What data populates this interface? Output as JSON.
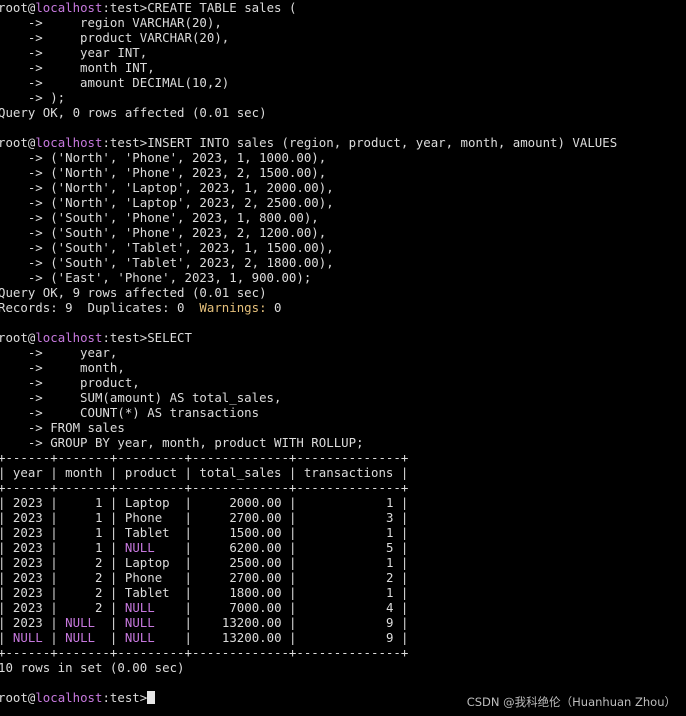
{
  "prompt": {
    "user": "root",
    "at": "@",
    "host": "localhost",
    "suffix": ":test>"
  },
  "create": {
    "command": "CREATE TABLE sales (",
    "cont": [
      "    ->     region VARCHAR(20),",
      "    ->     product VARCHAR(20),",
      "    ->     year INT,",
      "    ->     month INT,",
      "    ->     amount DECIMAL(10,2)",
      "    -> );"
    ],
    "result": "Query OK, 0 rows affected (0.01 sec)"
  },
  "insert": {
    "command": "INSERT INTO sales (region, product, year, month, amount) VALUES",
    "cont": [
      "    -> ('North', 'Phone', 2023, 1, 1000.00),",
      "    -> ('North', 'Phone', 2023, 2, 1500.00),",
      "    -> ('North', 'Laptop', 2023, 1, 2000.00),",
      "    -> ('North', 'Laptop', 2023, 2, 2500.00),",
      "    -> ('South', 'Phone', 2023, 1, 800.00),",
      "    -> ('South', 'Phone', 2023, 2, 1200.00),",
      "    -> ('South', 'Tablet', 2023, 1, 1500.00),",
      "    -> ('South', 'Tablet', 2023, 2, 1800.00),",
      "    -> ('East', 'Phone', 2023, 1, 900.00);"
    ],
    "result": "Query OK, 9 rows affected (0.01 sec)",
    "records_prefix": "Records: 9  Duplicates: 0  ",
    "warnings_label": "Warnings:",
    "warnings_value": " 0"
  },
  "select": {
    "command": "SELECT",
    "cont": [
      "    ->     year,",
      "    ->     month,",
      "    ->     product,",
      "    ->     SUM(amount) AS total_sales,",
      "    ->     COUNT(*) AS transactions",
      "    -> FROM sales",
      "    -> GROUP BY year, month, product WITH ROLLUP;"
    ]
  },
  "table": {
    "border": "+------+-------+---------+-------------+--------------+",
    "header": "| year | month | product | total_sales | transactions |",
    "rows": [
      {
        "year": "2023",
        "month": "1",
        "product": "Laptop",
        "total_sales": "2000.00",
        "transactions": "1"
      },
      {
        "year": "2023",
        "month": "1",
        "product": "Phone",
        "total_sales": "2700.00",
        "transactions": "3"
      },
      {
        "year": "2023",
        "month": "1",
        "product": "Tablet",
        "total_sales": "1500.00",
        "transactions": "1"
      },
      {
        "year": "2023",
        "month": "1",
        "product": "NULL",
        "total_sales": "6200.00",
        "transactions": "5"
      },
      {
        "year": "2023",
        "month": "2",
        "product": "Laptop",
        "total_sales": "2500.00",
        "transactions": "1"
      },
      {
        "year": "2023",
        "month": "2",
        "product": "Phone",
        "total_sales": "2700.00",
        "transactions": "2"
      },
      {
        "year": "2023",
        "month": "2",
        "product": "Tablet",
        "total_sales": "1800.00",
        "transactions": "1"
      },
      {
        "year": "2023",
        "month": "2",
        "product": "NULL",
        "total_sales": "7000.00",
        "transactions": "4"
      },
      {
        "year": "2023",
        "month": "NULL",
        "product": "NULL",
        "total_sales": "13200.00",
        "transactions": "9"
      },
      {
        "year": "NULL",
        "month": "NULL",
        "product": "NULL",
        "total_sales": "13200.00",
        "transactions": "9"
      }
    ],
    "footer": "10 rows in set (0.00 sec)"
  },
  "watermark": "CSDN @我科绝伦（Huanhuan Zhou）",
  "colors": {
    "background": "#000000",
    "text": "#dcdcdc",
    "host": "#c678dd",
    "null": "#c678dd",
    "warnings": "#e5c07b"
  }
}
